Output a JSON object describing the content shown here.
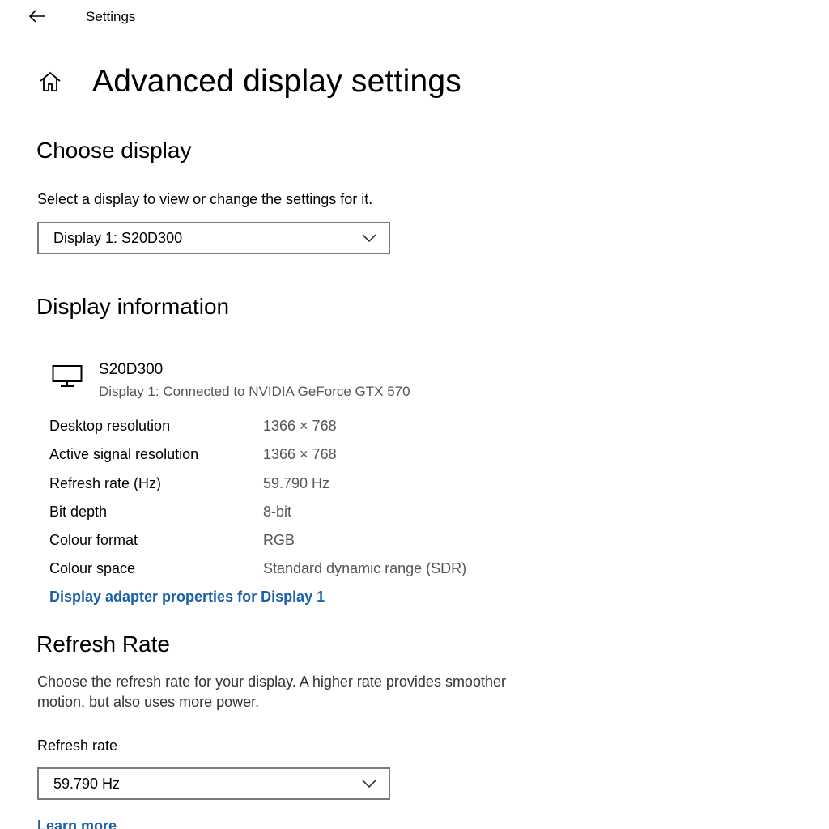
{
  "titlebar": {
    "app_title": "Settings"
  },
  "page": {
    "title": "Advanced display settings"
  },
  "choose_display": {
    "heading": "Choose display",
    "description": "Select a display to view or change the settings for it.",
    "selected": "Display 1: S20D300"
  },
  "display_information": {
    "heading": "Display information",
    "monitor_name": "S20D300",
    "monitor_connection": "Display 1: Connected to NVIDIA GeForce GTX 570",
    "rows": [
      {
        "label": "Desktop resolution",
        "value": "1366 × 768"
      },
      {
        "label": "Active signal resolution",
        "value": "1366 × 768"
      },
      {
        "label": "Refresh rate (Hz)",
        "value": "59.790 Hz"
      },
      {
        "label": "Bit depth",
        "value": "8-bit"
      },
      {
        "label": "Colour format",
        "value": "RGB"
      },
      {
        "label": "Colour space",
        "value": "Standard dynamic range (SDR)"
      }
    ],
    "adapter_link": "Display adapter properties for Display 1"
  },
  "refresh_rate": {
    "heading": "Refresh Rate",
    "description": "Choose the refresh rate for your display. A higher rate provides smoother motion, but also uses more power.",
    "field_label": "Refresh rate",
    "selected": "59.790 Hz",
    "learn_more": "Learn more"
  },
  "icons": {
    "back": "back-arrow-icon",
    "home": "home-icon",
    "monitor": "monitor-icon",
    "chevron": "chevron-down-icon"
  },
  "colors": {
    "link": "#1a5fa8",
    "secondary_text": "#555555",
    "border": "#7a7a7a"
  }
}
